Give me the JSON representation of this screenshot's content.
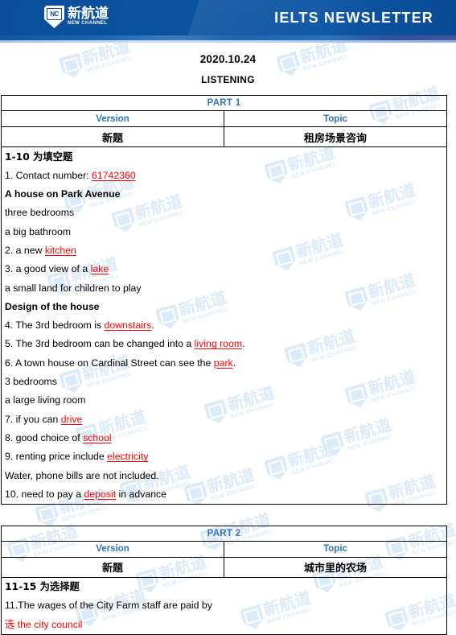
{
  "banner": {
    "logo_cn": "新航道",
    "logo_en": "NEW CHANNEL",
    "logo_mark": "NC",
    "title": "IELTS  NEWSLETTER",
    "brand_color": "#0a4f9e"
  },
  "document": {
    "date": "2020.10.24",
    "section": "LISTENING"
  },
  "colors": {
    "header_blue": "#2e74b5",
    "answer_red": "#ff0000",
    "banner_blue": "#0a4f9e",
    "watermark": "#dcebf9"
  },
  "watermark": {
    "cn": "新航道",
    "en": "NEW CHANNEL"
  },
  "parts": [
    {
      "title": "PART 1",
      "columns": {
        "version": "Version",
        "topic": "Topic"
      },
      "values": {
        "version": "新题",
        "topic": "租房场景咨询"
      },
      "instruction": "1-10 为填空题",
      "lines": [
        {
          "id": "l1",
          "bold": false,
          "segments": [
            {
              "text": "1. Contact number: ",
              "style": "normal"
            },
            {
              "text": "61742360",
              "style": "answer"
            }
          ]
        },
        {
          "id": "l2",
          "bold": true,
          "segments": [
            {
              "text": "A house on Park Avenue",
              "style": "normal"
            }
          ]
        },
        {
          "id": "l3",
          "bold": false,
          "segments": [
            {
              "text": "three bedrooms",
              "style": "normal"
            }
          ]
        },
        {
          "id": "l4",
          "bold": false,
          "segments": [
            {
              "text": "a big bathroom",
              "style": "normal"
            }
          ]
        },
        {
          "id": "l5",
          "bold": false,
          "segments": [
            {
              "text": "2. a new ",
              "style": "normal"
            },
            {
              "text": "kitchen",
              "style": "answer"
            }
          ]
        },
        {
          "id": "l6",
          "bold": false,
          "segments": [
            {
              "text": "3. a good view of a ",
              "style": "normal"
            },
            {
              "text": "lake",
              "style": "answer"
            }
          ]
        },
        {
          "id": "l7",
          "bold": false,
          "segments": [
            {
              "text": "a small land for children to play",
              "style": "normal"
            }
          ]
        },
        {
          "id": "l8",
          "bold": true,
          "segments": [
            {
              "text": "Design of the house",
              "style": "normal"
            }
          ]
        },
        {
          "id": "l9",
          "bold": false,
          "segments": [
            {
              "text": "4. The 3rd bedroom is ",
              "style": "normal"
            },
            {
              "text": "downstairs",
              "style": "answer"
            },
            {
              "text": ".",
              "style": "normal"
            }
          ]
        },
        {
          "id": "l10",
          "bold": false,
          "segments": [
            {
              "text": "5. The 3rd bedroom can be changed into a ",
              "style": "normal"
            },
            {
              "text": "living room",
              "style": "answer"
            },
            {
              "text": ".",
              "style": "normal"
            }
          ]
        },
        {
          "id": "l11",
          "bold": false,
          "segments": [
            {
              "text": "6. A town house on Cardinal Street can see the ",
              "style": "normal"
            },
            {
              "text": "park",
              "style": "answer"
            },
            {
              "text": ".",
              "style": "normal"
            }
          ]
        },
        {
          "id": "l12",
          "bold": false,
          "segments": [
            {
              "text": "3 bedrooms",
              "style": "normal"
            }
          ]
        },
        {
          "id": "l13",
          "bold": false,
          "segments": [
            {
              "text": "a large living room",
              "style": "normal"
            }
          ]
        },
        {
          "id": "l14",
          "bold": false,
          "segments": [
            {
              "text": "7. if you can ",
              "style": "normal"
            },
            {
              "text": "drive",
              "style": "answer"
            }
          ]
        },
        {
          "id": "l15",
          "bold": false,
          "segments": [
            {
              "text": "8. good choice of ",
              "style": "normal"
            },
            {
              "text": "school",
              "style": "answer"
            }
          ]
        },
        {
          "id": "l16",
          "bold": false,
          "segments": [
            {
              "text": "9. renting price include ",
              "style": "normal"
            },
            {
              "text": "electricity",
              "style": "answer"
            }
          ]
        },
        {
          "id": "l17",
          "bold": false,
          "segments": [
            {
              "text": "Water, phone bills are not included.",
              "style": "normal"
            }
          ]
        },
        {
          "id": "l18",
          "bold": false,
          "segments": [
            {
              "text": "10. need to pay a ",
              "style": "normal"
            },
            {
              "text": "deposit",
              "style": "answer"
            },
            {
              "text": " in advance",
              "style": "normal"
            }
          ]
        }
      ]
    },
    {
      "title": "PART 2",
      "columns": {
        "version": "Version",
        "topic": "Topic"
      },
      "values": {
        "version": "新题",
        "topic": "城市里的农场"
      },
      "instruction": "11-15 为选择题",
      "lines": [
        {
          "id": "p2l1",
          "bold": false,
          "segments": [
            {
              "text": "11.The wages of the City Farm staff are paid by",
              "style": "normal"
            }
          ]
        },
        {
          "id": "p2l2",
          "bold": false,
          "segments": [
            {
              "text": "选",
              "style": "answer-plain"
            },
            {
              "text": " the city council",
              "style": "answer-plain"
            }
          ]
        }
      ]
    }
  ]
}
